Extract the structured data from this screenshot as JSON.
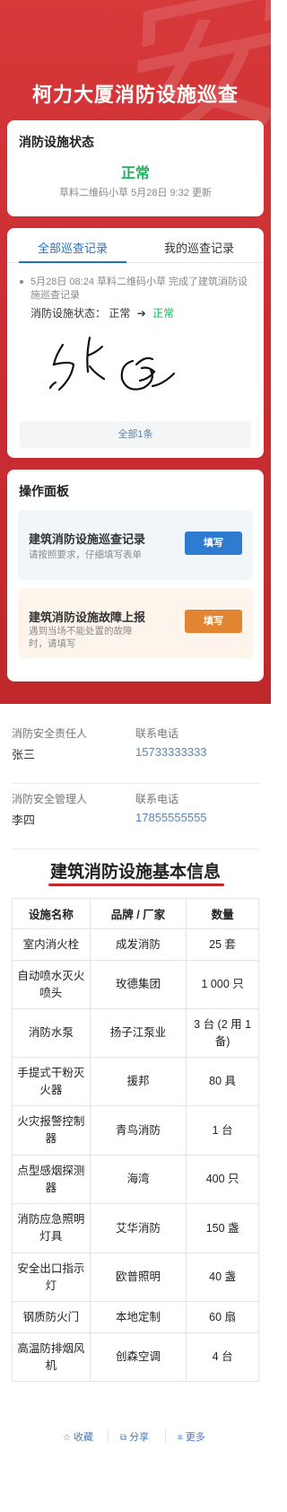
{
  "hero": {
    "watermark": "安",
    "title": "柯力大厦消防设施巡查"
  },
  "status_card": {
    "heading": "消防设施状态",
    "value": "正常",
    "meta": "草料二维码小草 5月28日 9:32 更新"
  },
  "records": {
    "tabs": [
      "全部巡查记录",
      "我的巡查记录"
    ],
    "entry": {
      "text": "5月28日 08:24  草料二维码小草 完成了建筑消防设施巡查记录",
      "status_label": "消防设施状态：",
      "old": "正常",
      "arrow": "➔",
      "new": "正常"
    },
    "total": "全部1条"
  },
  "ops": {
    "heading": "操作面板",
    "items": [
      {
        "title": "建筑消防设施巡查记录",
        "desc": "请按照要求，仔细填写表单",
        "button": "填写",
        "color": "#2f7bd0"
      },
      {
        "title": "建筑消防设施故障上报",
        "desc": "遇到当场不能处置的故障时，请填写",
        "button": "填写",
        "color": "#e28533"
      }
    ]
  },
  "contacts": [
    {
      "role_label": "消防安全责任人",
      "name": "张三",
      "phone_label": "联系电话",
      "phone": "15733333333"
    },
    {
      "role_label": "消防安全管理人",
      "name": "李四",
      "phone_label": "联系电话",
      "phone": "17855555555"
    }
  ],
  "info": {
    "title": "建筑消防设施基本信息",
    "headers": [
      "设施名称",
      "品牌 / 厂家",
      "数量"
    ],
    "rows": [
      [
        "室内消火栓",
        "成发消防",
        "25 套"
      ],
      [
        "自动喷水灭火喷头",
        "玫德集团",
        "1 000 只"
      ],
      [
        "消防水泵",
        "扬子江泵业",
        "3 台 (2 用 1 备)"
      ],
      [
        "手提式干粉灭火器",
        "援邦",
        "80 具"
      ],
      [
        "火灾报警控制器",
        "青鸟消防",
        "1 台"
      ],
      [
        "点型感烟探测器",
        "海湾",
        "400 只"
      ],
      [
        "消防应急照明灯具",
        "艾华消防",
        "150 盏"
      ],
      [
        "安全出口指示灯",
        "欧普照明",
        "40 盏"
      ],
      [
        "钢质防火门",
        "本地定制",
        "60 扇"
      ],
      [
        "高温防排烟风机",
        "创森空调",
        "4 台"
      ]
    ]
  },
  "footer": {
    "items": [
      {
        "icon": "☆",
        "icon_name": "star-icon",
        "label": "收藏"
      },
      {
        "icon": "⧉",
        "icon_name": "share-icon",
        "label": "分享"
      },
      {
        "icon": "≡",
        "icon_name": "more-icon",
        "label": "更多"
      }
    ]
  },
  "colors": {
    "brand_red": "#c92d31",
    "accent_blue": "#1f72c9",
    "status_green": "#22b25f",
    "warn_orange": "#e28533"
  }
}
